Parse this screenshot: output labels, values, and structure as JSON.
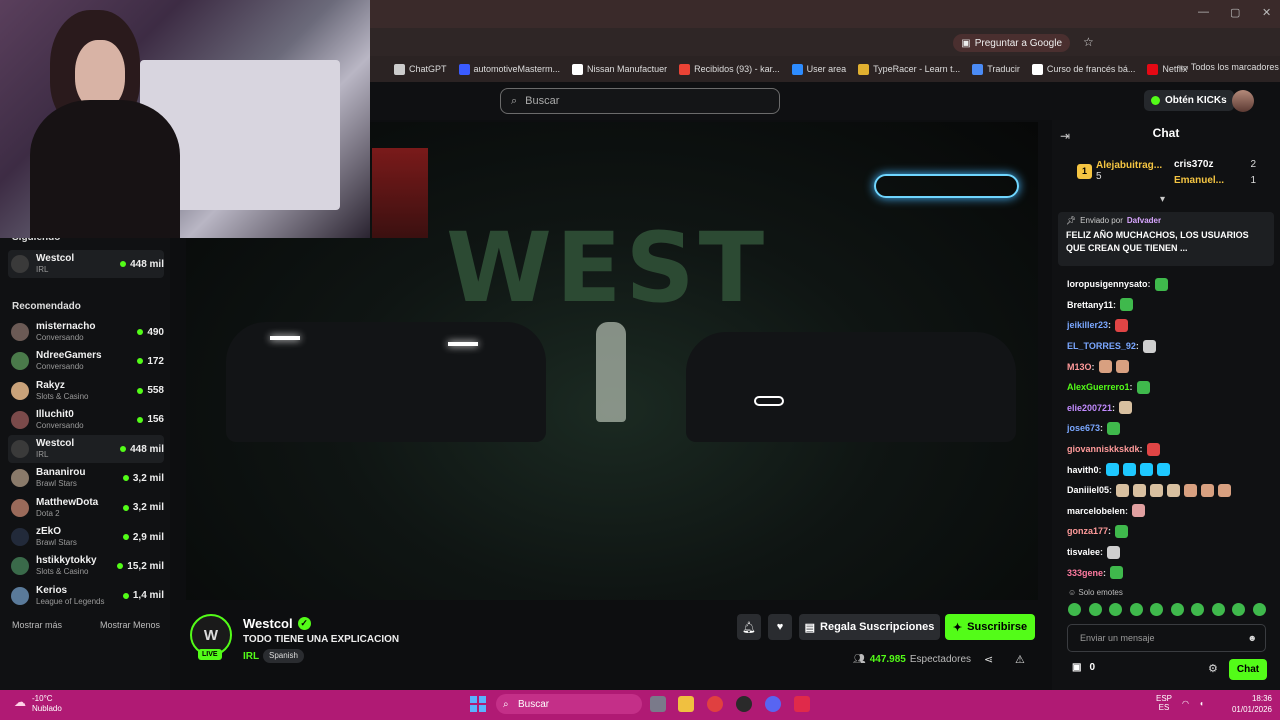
{
  "browser": {
    "bookmarks": [
      {
        "label": "ChatGPT",
        "color": "#cccccc"
      },
      {
        "label": "automotiveMasterm...",
        "color": "#3a5bff"
      },
      {
        "label": "Nissan Manufactuer",
        "color": "#ffffff"
      },
      {
        "label": "Recibidos (93) - kar...",
        "color": "#ea4335"
      },
      {
        "label": "User area",
        "color": "#2d8cff"
      },
      {
        "label": "TypeRacer - Learn t...",
        "color": "#e0b030"
      },
      {
        "label": "Traducir",
        "color": "#4b8bf5"
      },
      {
        "label": "Curso de francés bá...",
        "color": "#ffffff"
      },
      {
        "label": "Netflix",
        "color": "#e50914"
      }
    ],
    "all_bookmarks": "Todos los marcadores",
    "ask_google": "Preguntar a Google"
  },
  "header": {
    "search_placeholder": "Buscar",
    "kicks_label": "Obtén KICKs"
  },
  "sidebar": {
    "following_title": "Siguiendo",
    "following": [
      {
        "name": "Westcol",
        "category": "IRL",
        "viewers": "448 mil",
        "avatar": "#3a3a3a"
      }
    ],
    "recommended_title": "Recomendado",
    "recommended": [
      {
        "name": "misternacho",
        "category": "Conversando",
        "viewers": "490",
        "avatar": "#6b5a55"
      },
      {
        "name": "NdreeGamers",
        "category": "Conversando",
        "viewers": "172",
        "avatar": "#4a7a4a"
      },
      {
        "name": "Rakyz",
        "category": "Slots & Casino",
        "viewers": "558",
        "avatar": "#c9a27a"
      },
      {
        "name": "Illuchit0",
        "category": "Conversando",
        "viewers": "156",
        "avatar": "#7a4a4a"
      },
      {
        "name": "Westcol",
        "category": "IRL",
        "viewers": "448 mil",
        "avatar": "#3a3a3a"
      },
      {
        "name": "Bananirou",
        "category": "Brawl Stars",
        "viewers": "3,2 mil",
        "avatar": "#8a7a6a"
      },
      {
        "name": "MatthewDota",
        "category": "Dota 2",
        "viewers": "3,2 mil",
        "avatar": "#9a6a5a"
      },
      {
        "name": "zEkO",
        "category": "Brawl Stars",
        "viewers": "2,9 mil",
        "avatar": "#222a3a"
      },
      {
        "name": "hstikkytokky",
        "category": "Slots & Casino",
        "viewers": "15,2 mil",
        "avatar": "#3a6a4a"
      },
      {
        "name": "Kerios",
        "category": "League of Legends",
        "viewers": "1,4 mil",
        "avatar": "#5a7a9a"
      }
    ],
    "show_more": "Mostrar más",
    "show_less": "Mostrar Menos"
  },
  "stream": {
    "channel": "Westcol",
    "avatar_text": "W",
    "live": "LIVE",
    "title": "TODO TIENE UNA EXPLICACION",
    "category": "IRL",
    "language": "Spanish",
    "gift_label": "Regala Suscripciones",
    "subscribe_label": "Suscribirse",
    "viewers": "447.985",
    "viewers_label": "Espectadores",
    "graffiti": "WEST"
  },
  "chat": {
    "title": "Chat",
    "gifters": [
      {
        "rank": "1",
        "name": "Alejabuitrag...",
        "count": "5",
        "color": "#f5c542"
      },
      {
        "rank": "",
        "name": "cris370z",
        "count": "2",
        "color": "#ffffff"
      },
      {
        "rank": "",
        "name": "Emanuel...",
        "count": "1",
        "color": "#f5c542"
      }
    ],
    "pinned_by_label": "Enviado por",
    "pinned_by": "Dafvader",
    "pinned_message": "FELIZ AÑO MUCHACHOS, LOS USUARIOS QUE CREAN QUE TIENEN ...",
    "messages": [
      {
        "user": "loropusigennysato",
        "color": "#ffffff",
        "emotes": [
          "#3fb94c"
        ]
      },
      {
        "user": "Brettany11",
        "color": "#ffffff",
        "emotes": [
          "#3fb94c"
        ]
      },
      {
        "user": "jeikiller23",
        "color": "#7aa7ff",
        "emotes": [
          "#e04545"
        ]
      },
      {
        "user": "EL_TORRES_92",
        "color": "#7aa7ff",
        "emotes": [
          "#cfcfcf"
        ]
      },
      {
        "user": "M13O",
        "color": "#ff9a9a",
        "emotes": [
          "#d8a080",
          "#d8a080"
        ]
      },
      {
        "user": "AlexGuerrero1",
        "color": "#53fc18",
        "emotes": [
          "#3fb94c"
        ]
      },
      {
        "user": "elie200721",
        "color": "#c28bff",
        "emotes": [
          "#d8c0a0"
        ]
      },
      {
        "user": "jose673",
        "color": "#7aa7ff",
        "emotes": [
          "#3fb94c"
        ]
      },
      {
        "user": "giovanniskkskdk",
        "color": "#ff9a9a",
        "emotes": [
          "#e04545"
        ]
      },
      {
        "user": "havith0",
        "color": "#ffffff",
        "emotes": [
          "#1ec8ff",
          "#1ec8ff",
          "#1ec8ff",
          "#1ec8ff"
        ]
      },
      {
        "user": "Daniiiel05",
        "color": "#ffffff",
        "emotes": [
          "#d8c0a0",
          "#d8c0a0",
          "#d8c0a0",
          "#d8c0a0",
          "#d8a080",
          "#d8a080",
          "#d8a080"
        ]
      },
      {
        "user": "marcelobelen",
        "color": "#ffffff",
        "emotes": [
          "#e0a0a0"
        ]
      },
      {
        "user": "gonza177",
        "color": "#ff9a9a",
        "emotes": [
          "#3fb94c"
        ]
      },
      {
        "user": "tisvalee",
        "color": "#ffffff",
        "emotes": [
          "#cfcfcf"
        ]
      },
      {
        "user": "333gene",
        "color": "#ff7aa0",
        "emotes": [
          "#3fb94c"
        ]
      }
    ],
    "emote_only": "Solo emotes",
    "input_placeholder": "Enviar un mensaje",
    "points": "0",
    "send_label": "Chat"
  },
  "taskbar": {
    "temperature": "-10°C",
    "weather": "Nublado",
    "search": "Buscar",
    "lang_top": "ESP",
    "lang_bottom": "ES",
    "time": "18:36",
    "date": "01/01/2026"
  }
}
